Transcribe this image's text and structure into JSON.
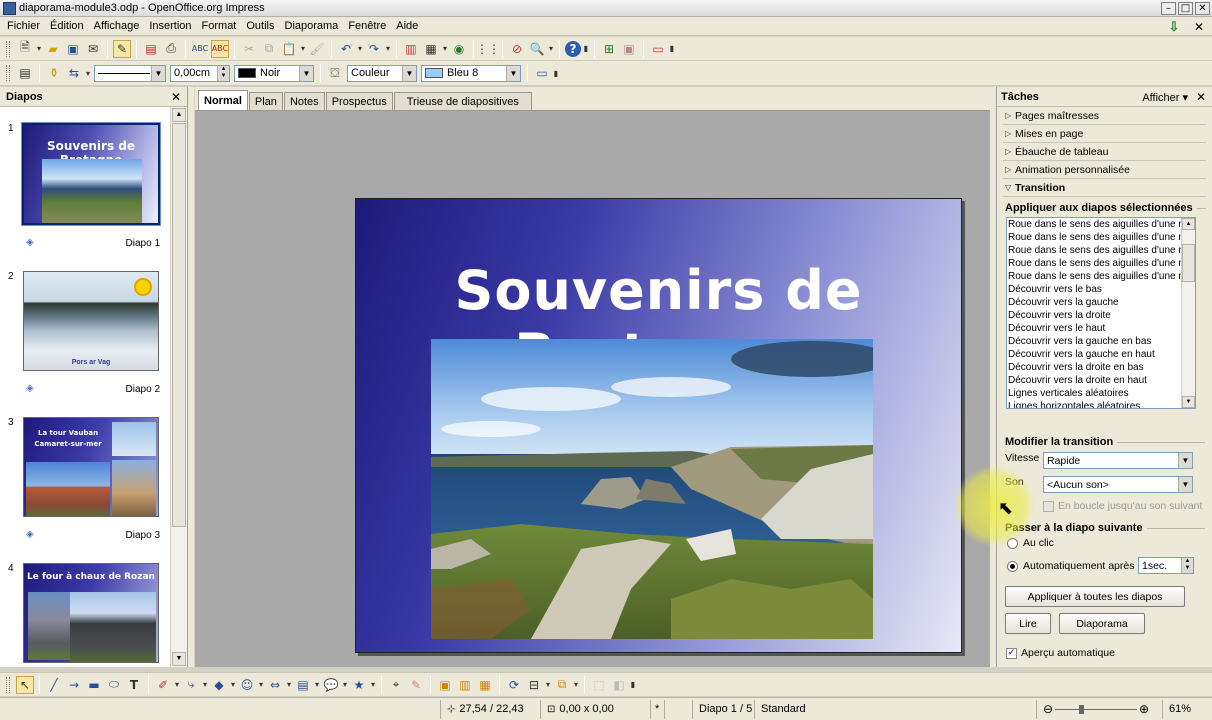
{
  "window": {
    "title": "diaporama-module3.odp - OpenOffice.org Impress"
  },
  "menubar": {
    "items": [
      "Fichier",
      "Édition",
      "Affichage",
      "Insertion",
      "Format",
      "Outils",
      "Diaporama",
      "Fenêtre",
      "Aide"
    ]
  },
  "toolbar2": {
    "line_width": "0,00cm",
    "line_color": "Noir",
    "line_color_hex": "#000000",
    "area_style": "Couleur",
    "area_color": "Bleu 8",
    "area_color_hex": "#99ccff"
  },
  "slides_panel": {
    "title": "Diapos",
    "slides": [
      {
        "number": "1",
        "label": "Diapo 1",
        "thumb_title": "Souvenirs de Bretagne"
      },
      {
        "number": "2",
        "label": "Diapo 2",
        "thumb_caption": "Pors ar Vag"
      },
      {
        "number": "3",
        "label": "Diapo 3",
        "thumb_title": "La tour Vauban Camaret-sur-mer"
      },
      {
        "number": "4",
        "thumb_title": "Le four à chaux de Rozan"
      }
    ]
  },
  "view_tabs": [
    "Normal",
    "Plan",
    "Notes",
    "Prospectus",
    "Trieuse de diapositives"
  ],
  "slide": {
    "title": "Souvenirs de Bretagne"
  },
  "tasks_panel": {
    "title": "Tâches",
    "view_label": "Afficher",
    "sections": [
      {
        "label": "Pages maîtresses",
        "open": false
      },
      {
        "label": "Mises en page",
        "open": false
      },
      {
        "label": "Ébauche de tableau",
        "open": false
      },
      {
        "label": "Animation personnalisée",
        "open": false
      },
      {
        "label": "Transition",
        "open": true
      }
    ],
    "apply_group": "Appliquer aux diapos sélectionnées",
    "transitions": [
      "Roue dans le sens des aiguilles d'une m",
      "Roue dans le sens des aiguilles d'une m",
      "Roue dans le sens des aiguilles d'une m",
      "Roue dans le sens des aiguilles d'une m",
      "Roue dans le sens des aiguilles d'une m",
      "Découvrir vers le bas",
      "Découvrir vers la gauche",
      "Découvrir vers la droite",
      "Découvrir vers le haut",
      "Découvrir vers la gauche en bas",
      "Découvrir vers la gauche en haut",
      "Découvrir vers la droite en bas",
      "Découvrir vers la droite en haut",
      "Lignes verticales aléatoires",
      "Lignes horizontales aléatoires"
    ],
    "modify_group": "Modifier la transition",
    "speed_label": "Vitesse",
    "speed_value": "Rapide",
    "sound_label": "Son",
    "sound_value": "<Aucun son>",
    "loop_label": "En boucle jusqu'au son suivant",
    "next_group": "Passer à la diapo suivante",
    "on_click_label": "Au clic",
    "auto_label": "Automatiquement après",
    "auto_value": "1sec.",
    "apply_all_button": "Appliquer à toutes les diapos",
    "play_button": "Lire",
    "slideshow_button": "Diaporama",
    "preview_label": "Aperçu automatique"
  },
  "statusbar": {
    "position": "27,54 / 22,43",
    "size": "0,00 x 0,00",
    "modified": "*",
    "slide_info": "Diapo 1 / 5",
    "master": "Standard",
    "zoom": "61%"
  }
}
